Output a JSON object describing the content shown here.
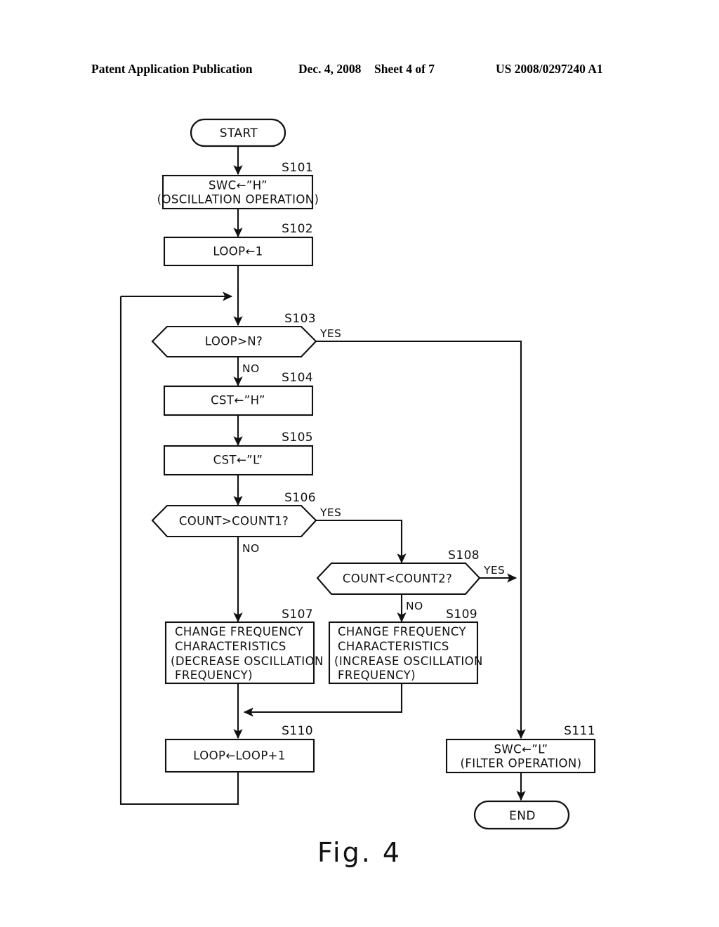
{
  "header": {
    "publication": "Patent Application Publication",
    "date": "Dec. 4, 2008",
    "sheet": "Sheet 4 of 7",
    "patent_number": "US 2008/0297240 A1"
  },
  "figure": {
    "caption": "Fig. 4"
  },
  "chart_data": {
    "type": "flowchart",
    "title": "Fig. 4",
    "nodes": [
      {
        "id": "start",
        "shape": "terminator",
        "step": "",
        "lines": [
          "START"
        ]
      },
      {
        "id": "s101",
        "shape": "process",
        "step": "S101",
        "lines": [
          "SWC←”H”",
          "(OSCILLATION OPERATION)"
        ]
      },
      {
        "id": "s102",
        "shape": "process",
        "step": "S102",
        "lines": [
          "LOOP←1"
        ]
      },
      {
        "id": "s103",
        "shape": "decision",
        "step": "S103",
        "lines": [
          "LOOP>N?"
        ],
        "yes": "YES",
        "no": "NO"
      },
      {
        "id": "s104",
        "shape": "process",
        "step": "S104",
        "lines": [
          "CST←”H”"
        ]
      },
      {
        "id": "s105",
        "shape": "process",
        "step": "S105",
        "lines": [
          "CST←”L”"
        ]
      },
      {
        "id": "s106",
        "shape": "decision",
        "step": "S106",
        "lines": [
          "COUNT>COUNT1?"
        ],
        "yes": "YES",
        "no": "NO"
      },
      {
        "id": "s108",
        "shape": "decision",
        "step": "S108",
        "lines": [
          "COUNT<COUNT2?"
        ],
        "yes": "YES",
        "no": "NO"
      },
      {
        "id": "s107",
        "shape": "process",
        "step": "S107",
        "lines": [
          "CHANGE FREQUENCY",
          "CHARACTERISTICS",
          "(DECREASE OSCILLATION",
          "FREQUENCY)"
        ]
      },
      {
        "id": "s109",
        "shape": "process",
        "step": "S109",
        "lines": [
          "CHANGE FREQUENCY",
          "CHARACTERISTICS",
          "(INCREASE OSCILLATION",
          "FREQUENCY)"
        ]
      },
      {
        "id": "s110",
        "shape": "process",
        "step": "S110",
        "lines": [
          "LOOP←LOOP+1"
        ]
      },
      {
        "id": "s111",
        "shape": "process",
        "step": "S111",
        "lines": [
          "SWC←”L”",
          "(FILTER OPERATION)"
        ]
      },
      {
        "id": "end",
        "shape": "terminator",
        "step": "",
        "lines": [
          "END"
        ]
      }
    ],
    "edges": [
      {
        "from": "start",
        "to": "s101",
        "label": ""
      },
      {
        "from": "s101",
        "to": "s102",
        "label": ""
      },
      {
        "from": "s102",
        "to": "s103",
        "label": ""
      },
      {
        "from": "s103",
        "to": "s104",
        "label": "NO"
      },
      {
        "from": "s103",
        "to": "s111",
        "label": "YES"
      },
      {
        "from": "s104",
        "to": "s105",
        "label": ""
      },
      {
        "from": "s105",
        "to": "s106",
        "label": ""
      },
      {
        "from": "s106",
        "to": "s107",
        "label": "NO"
      },
      {
        "from": "s106",
        "to": "s108",
        "label": "YES"
      },
      {
        "from": "s108",
        "to": "s109",
        "label": "NO"
      },
      {
        "from": "s108",
        "to": "s111",
        "label": "YES"
      },
      {
        "from": "s107",
        "to": "s110",
        "label": ""
      },
      {
        "from": "s109",
        "to": "s110",
        "label": ""
      },
      {
        "from": "s110",
        "to": "s103",
        "label": ""
      },
      {
        "from": "s111",
        "to": "end",
        "label": ""
      }
    ]
  },
  "nodes": {
    "start": {
      "text": "START"
    },
    "s101": {
      "step": "S101",
      "l1": "SWC←”H”",
      "l2": "(OSCILLATION OPERATION)"
    },
    "s102": {
      "step": "S102",
      "l1": "LOOP←1"
    },
    "s103": {
      "step": "S103",
      "l1": "LOOP>N?",
      "yes": "YES",
      "no": "NO"
    },
    "s104": {
      "step": "S104",
      "l1": "CST←”H”"
    },
    "s105": {
      "step": "S105",
      "l1": "CST←”L”"
    },
    "s106": {
      "step": "S106",
      "l1": "COUNT>COUNT1?",
      "yes": "YES",
      "no": "NO"
    },
    "s108": {
      "step": "S108",
      "l1": "COUNT<COUNT2?",
      "yes": "YES",
      "no": "NO"
    },
    "s107": {
      "step": "S107",
      "l1": "CHANGE FREQUENCY",
      "l2": "CHARACTERISTICS",
      "l3": "(DECREASE OSCILLATION",
      "l4": "FREQUENCY)"
    },
    "s109": {
      "step": "S109",
      "l1": "CHANGE FREQUENCY",
      "l2": "CHARACTERISTICS",
      "l3": "(INCREASE OSCILLATION",
      "l4": "FREQUENCY)"
    },
    "s110": {
      "step": "S110",
      "l1": "LOOP←LOOP+1"
    },
    "s111": {
      "step": "S111",
      "l1": "SWC←”L”",
      "l2": "(FILTER OPERATION)"
    },
    "end": {
      "text": "END"
    }
  }
}
